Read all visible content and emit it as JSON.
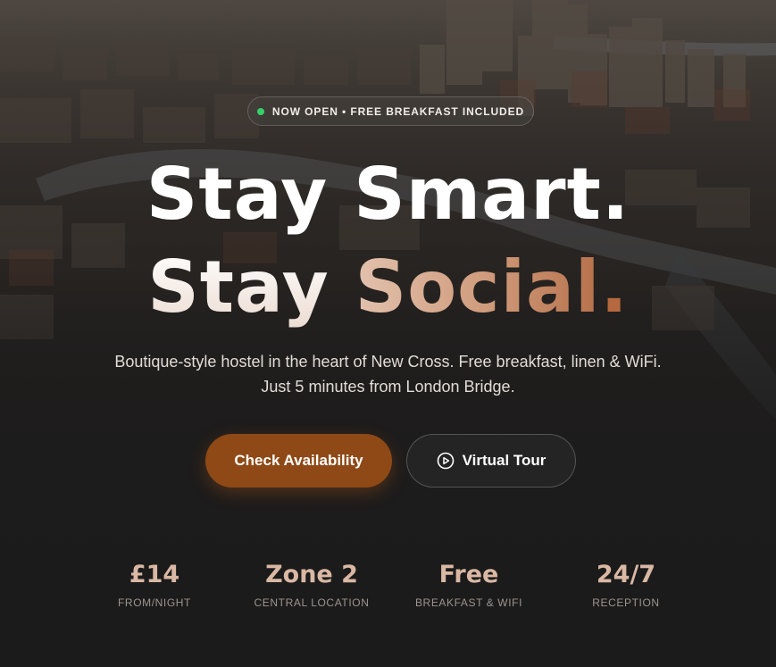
{
  "badge": {
    "text": "NOW OPEN • FREE BREAKFAST INCLUDED",
    "status_color": "#35d06a"
  },
  "headline": {
    "line1": "Stay Smart.",
    "line2_word1": "Stay",
    "line2_word2": "Social",
    "line2_period": "."
  },
  "subtitle": {
    "line1": "Boutique-style hostel in the heart of New Cross. Free breakfast, linen & WiFi.",
    "line2": "Just 5 minutes from London Bridge."
  },
  "actions": {
    "primary_label": "Check Availability",
    "secondary_label": "Virtual Tour",
    "secondary_icon": "play-circle-icon"
  },
  "stats": [
    {
      "value": "£14",
      "label": "FROM/NIGHT"
    },
    {
      "value": "Zone 2",
      "label": "CENTRAL LOCATION"
    },
    {
      "value": "Free",
      "label": "BREAKFAST & WIFI"
    },
    {
      "value": "24/7",
      "label": "RECEPTION"
    }
  ],
  "colors": {
    "accent": "#8e4916",
    "stat_value": "#d9b8a4",
    "background": "#1c1b1b"
  }
}
